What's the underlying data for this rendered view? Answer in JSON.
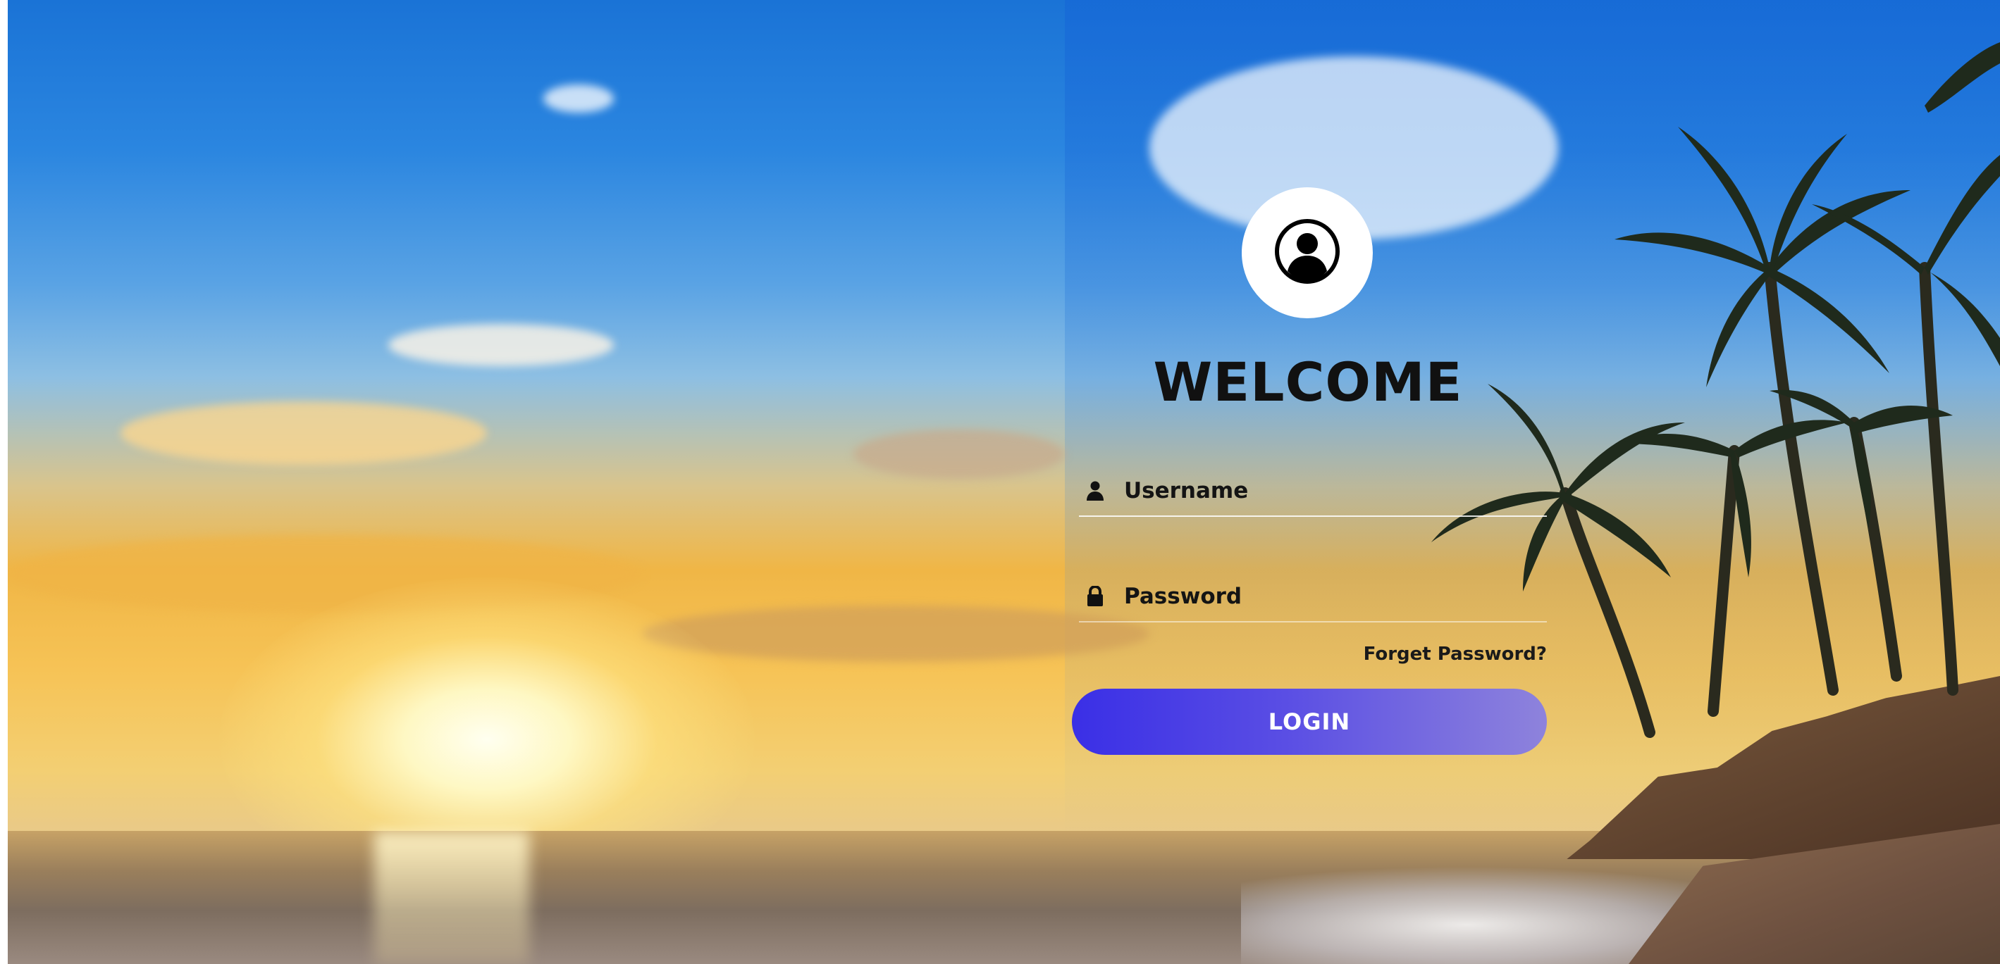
{
  "login": {
    "title": "WELCOME",
    "username_placeholder": "Username",
    "password_placeholder": "Password",
    "forget_password_label": "Forget Password?",
    "login_button_label": "LOGIN"
  },
  "icons": {
    "avatar": "user-circle-icon",
    "username": "user-icon",
    "password": "lock-icon"
  },
  "colors": {
    "button_gradient_start": "#3a2fe6",
    "button_gradient_end": "#8e83dc",
    "title_text": "#111111",
    "field_underline": "#ffffff"
  }
}
